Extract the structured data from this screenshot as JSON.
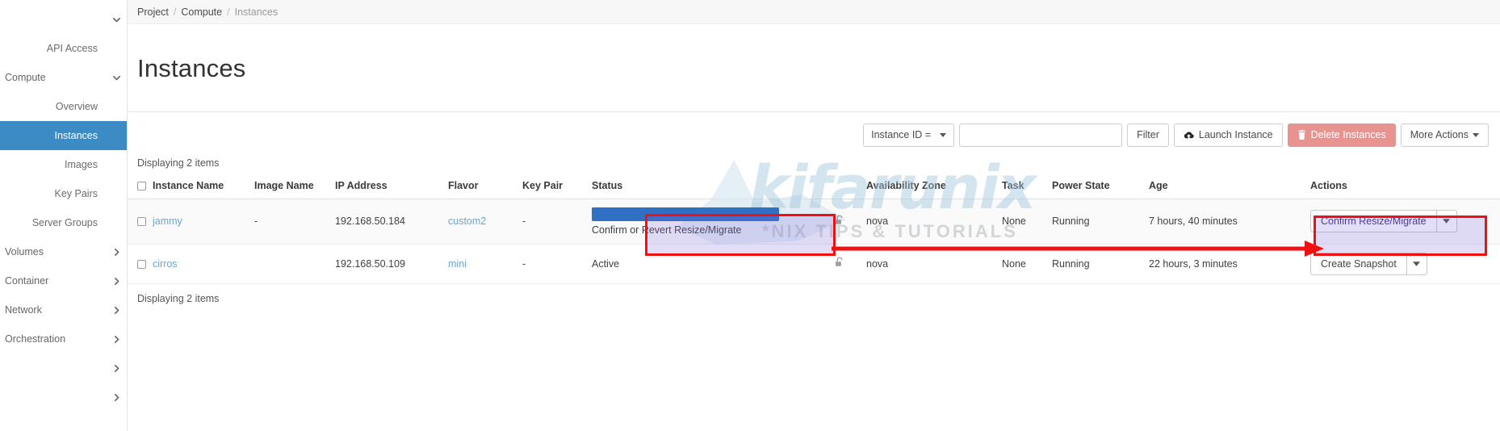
{
  "sidebar": {
    "items": [
      {
        "label": "",
        "type": "collapse-toggle",
        "icon": "chevron-down-icon",
        "name": "sidebar-toggle-top"
      },
      {
        "label": "API Access",
        "type": "child",
        "icon": "",
        "name": "sidebar-item-api-access"
      },
      {
        "label": "Compute",
        "type": "group-open",
        "icon": "chevron-down-icon",
        "name": "sidebar-group-compute"
      },
      {
        "label": "Overview",
        "type": "child",
        "icon": "",
        "name": "sidebar-item-overview"
      },
      {
        "label": "Instances",
        "type": "child-active",
        "icon": "",
        "name": "sidebar-item-instances"
      },
      {
        "label": "Images",
        "type": "child",
        "icon": "",
        "name": "sidebar-item-images"
      },
      {
        "label": "Key Pairs",
        "type": "child",
        "icon": "",
        "name": "sidebar-item-key-pairs"
      },
      {
        "label": "Server Groups",
        "type": "child",
        "icon": "",
        "name": "sidebar-item-server-groups"
      },
      {
        "label": "Volumes",
        "type": "group",
        "icon": "chevron-right-icon",
        "name": "sidebar-group-volumes"
      },
      {
        "label": "Container",
        "type": "group",
        "icon": "chevron-right-icon",
        "name": "sidebar-group-container"
      },
      {
        "label": "Network",
        "type": "group",
        "icon": "chevron-right-icon",
        "name": "sidebar-group-network"
      },
      {
        "label": "Orchestration",
        "type": "group",
        "icon": "chevron-right-icon",
        "name": "sidebar-group-orchestration"
      },
      {
        "label": "",
        "type": "group",
        "icon": "chevron-right-icon",
        "name": "sidebar-group-unlabeled-1"
      },
      {
        "label": "",
        "type": "group",
        "icon": "chevron-right-icon",
        "name": "sidebar-group-unlabeled-2"
      }
    ]
  },
  "breadcrumb": {
    "items": [
      "Project",
      "Compute",
      "Instances"
    ],
    "separator": "/"
  },
  "page": {
    "title": "Instances"
  },
  "toolbar": {
    "filter_field_label": "Instance ID =",
    "filter_input_value": "",
    "filter_input_placeholder": "",
    "filter_button": "Filter",
    "launch_instance_button": "Launch Instance",
    "delete_instances_button": "Delete Instances",
    "more_actions_button": "More Actions",
    "launch_icon": "cloud-upload-icon",
    "delete_icon": "trash-icon",
    "danger_color": "#e8938f"
  },
  "table": {
    "count_top": "Displaying 2 items",
    "count_bottom": "Displaying 2 items",
    "columns": [
      "Instance Name",
      "Image Name",
      "IP Address",
      "Flavor",
      "Key Pair",
      "Status",
      "",
      "Availability Zone",
      "Task",
      "Power State",
      "Age",
      "Actions"
    ],
    "rows": [
      {
        "name": "jammy",
        "image_name": "-",
        "ip_address": "192.168.50.184",
        "flavor": "custom2",
        "key_pair": "-",
        "status": "Confirm or Revert Resize/Migrate",
        "status_selected": true,
        "lock_icon": "unlocked-padlock-icon",
        "availability_zone": "nova",
        "task": "None",
        "power_state": "Running",
        "age": "7 hours, 40 minutes",
        "action_label": "Confirm Resize/Migrate",
        "action_highlighted": true
      },
      {
        "name": "cirros",
        "image_name": "",
        "ip_address": "192.168.50.109",
        "flavor": "mini",
        "key_pair": "-",
        "status": "Active",
        "status_selected": false,
        "lock_icon": "unlocked-padlock-icon",
        "availability_zone": "nova",
        "task": "None",
        "power_state": "Running",
        "age": "22 hours, 3 minutes",
        "action_label": "Create Snapshot",
        "action_highlighted": false
      }
    ]
  },
  "annotations": {
    "highlight_color": "#f01010",
    "highlight_fill": "#7e6ade"
  },
  "watermark": {
    "main": "kifarunix",
    "sub": "*NIX TIPS & TUTORIALS"
  }
}
